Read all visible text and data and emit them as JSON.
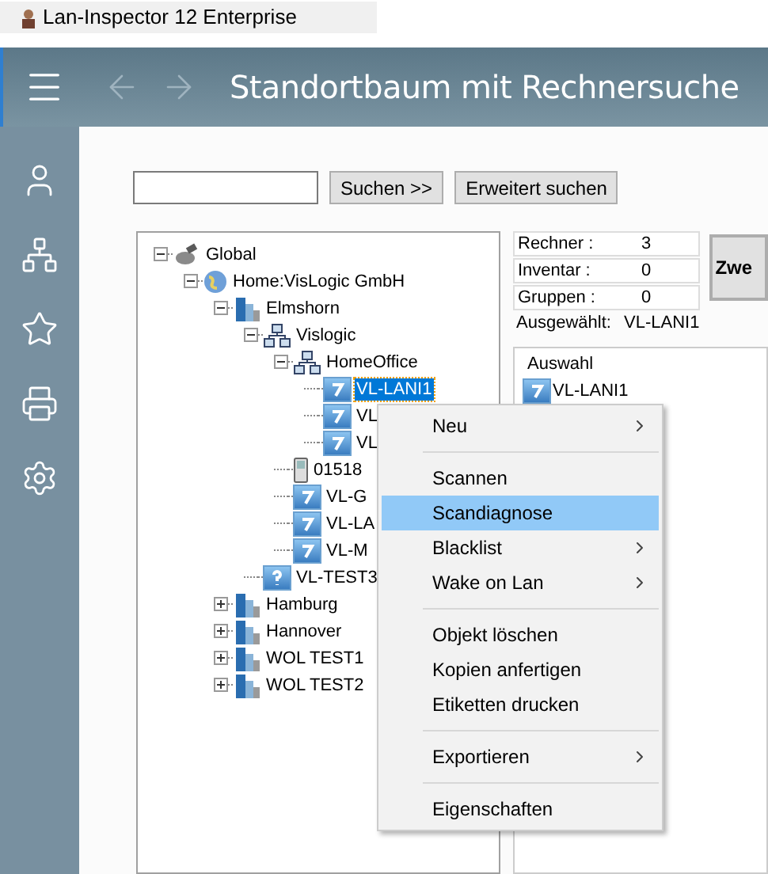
{
  "window": {
    "title": "Lan-Inspector 12 Enterprise"
  },
  "header": {
    "title": "Standortbaum mit Rechnersuche",
    "back_disabled": true,
    "forward_disabled": true
  },
  "sidebar": {
    "items": [
      {
        "kind": "user",
        "selected": false
      },
      {
        "kind": "tree",
        "selected": false
      },
      {
        "kind": "favorite",
        "selected": false
      },
      {
        "kind": "print",
        "selected": false
      },
      {
        "kind": "settings",
        "selected": false
      }
    ]
  },
  "search": {
    "buttons": [
      "Suchen >>",
      "Erweitert suchen"
    ]
  },
  "tree": [
    {
      "label": "Global",
      "kind": "root",
      "expanded": true,
      "selected": false,
      "children": [
        {
          "label": "Home:VisLogic GmbH",
          "kind": "site",
          "expanded": true,
          "selected": false,
          "children": [
            {
              "label": "Elmshorn",
              "kind": "building",
              "expanded": true,
              "selected": false,
              "children": [
                {
                  "label": "Vislogic",
                  "kind": "network",
                  "expanded": true,
                  "selected": false,
                  "children": [
                    {
                      "label": "HomeOffice",
                      "kind": "network",
                      "expanded": true,
                      "selected": false,
                      "children": [
                        {
                          "label": "VL-LANI1",
                          "kind": "computer",
                          "selected": true
                        },
                        {
                          "label": "VL",
                          "kind": "computer",
                          "selected": false
                        },
                        {
                          "label": "VL",
                          "kind": "computer",
                          "selected": false
                        }
                      ]
                    },
                    {
                      "label": "01518",
                      "kind": "phone",
                      "selected": false
                    },
                    {
                      "label": "VL-G",
                      "kind": "computer",
                      "selected": false
                    },
                    {
                      "label": "VL-LA",
                      "kind": "computer",
                      "selected": false
                    },
                    {
                      "label": "VL-M",
                      "kind": "computer",
                      "selected": false
                    }
                  ]
                },
                {
                  "label": "VL-TEST3",
                  "kind": "unknown",
                  "selected": false
                }
              ]
            },
            {
              "label": "Hamburg",
              "kind": "building",
              "expanded": false,
              "selected": false
            },
            {
              "label": "Hannover",
              "kind": "building",
              "expanded": false,
              "selected": false
            },
            {
              "label": "WOL TEST1",
              "kind": "building",
              "expanded": false,
              "selected": false
            },
            {
              "label": "WOL TEST2",
              "kind": "building",
              "expanded": false,
              "selected": false
            }
          ]
        }
      ]
    }
  ],
  "stats": [
    {
      "label": "Rechner :",
      "value": "3"
    },
    {
      "label": "Inventar :",
      "value": "0"
    },
    {
      "label": "Gruppen :",
      "value": "0"
    }
  ],
  "selected_info": {
    "label": "Ausgewählt:",
    "value": "VL-LANI1"
  },
  "action_button": "Zwe",
  "selection_box": {
    "title": "Auswahl",
    "items": [
      "VL-LANI1"
    ]
  },
  "context_menu": [
    {
      "kind": "item",
      "label": "Neu",
      "submenu": true,
      "selected": false
    },
    {
      "kind": "separator"
    },
    {
      "kind": "item",
      "label": "Scannen",
      "submenu": false,
      "selected": false
    },
    {
      "kind": "item",
      "label": "Scandiagnose",
      "submenu": false,
      "selected": true
    },
    {
      "kind": "item",
      "label": "Blacklist",
      "submenu": true,
      "selected": false
    },
    {
      "kind": "item",
      "label": "Wake on Lan",
      "submenu": true,
      "selected": false
    },
    {
      "kind": "separator"
    },
    {
      "kind": "item",
      "label": "Objekt löschen",
      "submenu": false,
      "selected": false
    },
    {
      "kind": "item",
      "label": "Kopien anfertigen",
      "submenu": false,
      "selected": false
    },
    {
      "kind": "item",
      "label": "Etiketten drucken",
      "submenu": false,
      "selected": false
    },
    {
      "kind": "separator"
    },
    {
      "kind": "item",
      "label": "Exportieren",
      "submenu": true,
      "selected": false
    },
    {
      "kind": "separator"
    },
    {
      "kind": "item",
      "label": "Eigenschaften",
      "submenu": false,
      "selected": false
    }
  ]
}
